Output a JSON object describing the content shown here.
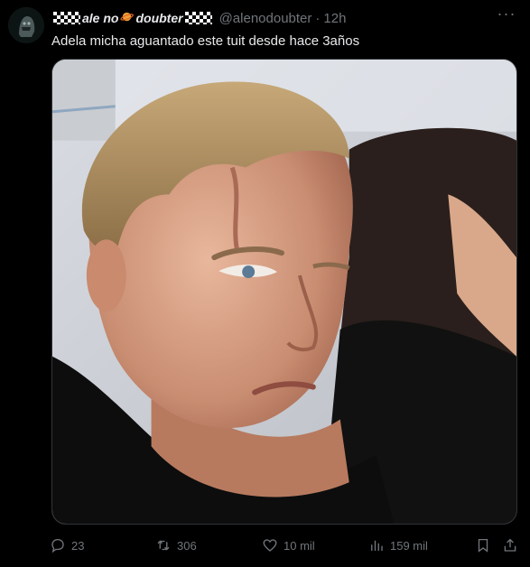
{
  "tweet": {
    "author_name_part1": "ale no",
    "author_name_part2": "doubter",
    "handle": "@alenodoubter",
    "separator": "·",
    "time": "12h",
    "text": "Adela micha aguantado este tuit desde hace 3años",
    "more_label": "···"
  },
  "actions": {
    "replies": "23",
    "retweets": "306",
    "likes": "10 mil",
    "views": "159 mil"
  },
  "colors": {
    "background": "#000000",
    "text": "#e7e9ea",
    "muted": "#71767b"
  },
  "icons": {
    "avatar": "avatar",
    "planet": "planet-emoji-icon",
    "reply": "reply-icon",
    "retweet": "retweet-icon",
    "like": "heart-icon",
    "views": "views-icon",
    "bookmark": "bookmark-icon",
    "share": "share-icon"
  }
}
